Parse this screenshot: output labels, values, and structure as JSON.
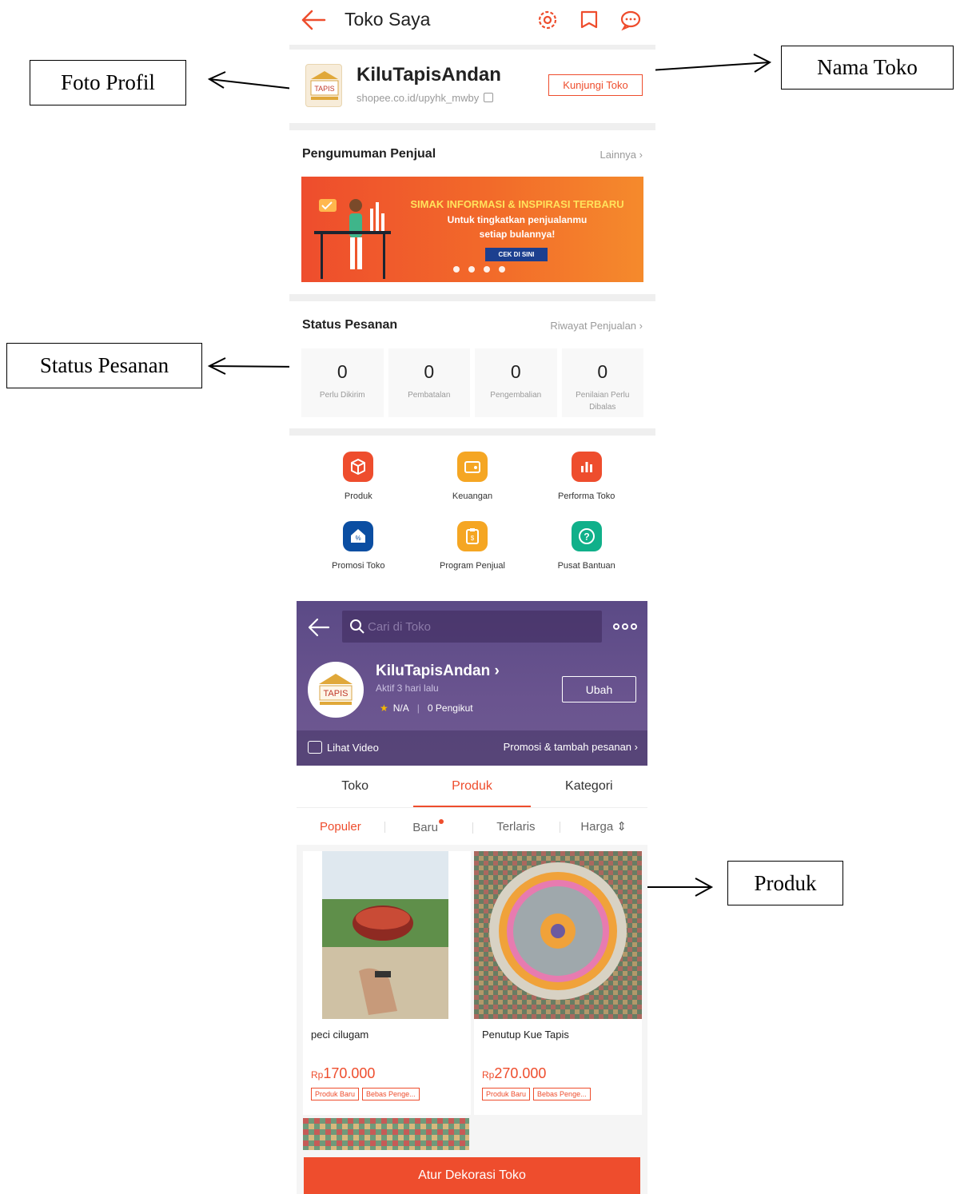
{
  "annotations": {
    "foto_profil": "Foto Profil",
    "nama_toko": "Nama Toko",
    "status_pesanan": "Status Pesanan",
    "produk": "Produk"
  },
  "screen1": {
    "title": "Toko Saya",
    "icons": [
      "settings-icon",
      "notification-icon",
      "chat-icon"
    ],
    "shop": {
      "name": "KiluTapisAndan",
      "link": "shopee.co.id/upyhk_mwby",
      "visit_button": "Kunjungi Toko",
      "avatar_text": "TAPIS"
    },
    "announcement": {
      "title": "Pengumuman Penjual",
      "more": "Lainnya",
      "banner": {
        "line1": "SIMAK INFORMASI & INSPIRASI TERBARU",
        "line2": "Untuk tingkatkan penjualanmu",
        "line3": "setiap bulannya!",
        "cta": "CEK DI SINI"
      }
    },
    "order_status": {
      "title": "Status Pesanan",
      "more": "Riwayat Penjualan",
      "items": [
        {
          "count": "0",
          "label": "Perlu Dikirim"
        },
        {
          "count": "0",
          "label": "Pembatalan"
        },
        {
          "count": "0",
          "label": "Pengembalian"
        },
        {
          "count": "0",
          "label": "Penilaian Perlu Dibalas"
        }
      ]
    },
    "menu": [
      {
        "label": "Produk",
        "color": "#ee4d2d",
        "icon": "box-icon"
      },
      {
        "label": "Keuangan",
        "color": "#f5a623",
        "icon": "wallet-icon"
      },
      {
        "label": "Performa Toko",
        "color": "#ee4d2d",
        "icon": "bar-chart-icon"
      },
      {
        "label": "Promosi Toko",
        "color": "#0b4ea2",
        "icon": "discount-icon"
      },
      {
        "label": "Program Penjual",
        "color": "#f5a623",
        "icon": "clipboard-icon"
      },
      {
        "label": "Pusat Bantuan",
        "color": "#10b08a",
        "icon": "help-icon"
      }
    ]
  },
  "screen2": {
    "search_placeholder": "Cari di Toko",
    "shop_name": "KiluTapisAndan",
    "active": "Aktif 3 hari lalu",
    "rating": "N/A",
    "followers": "0 Pengikut",
    "edit_button": "Ubah",
    "video": "Lihat Video",
    "promo": "Promosi & tambah pesanan",
    "tabs": [
      "Toko",
      "Produk",
      "Kategori"
    ],
    "sort": [
      "Populer",
      "Baru",
      "Terlaris",
      "Harga"
    ],
    "products": [
      {
        "name": "peci cilugam",
        "currency": "Rp",
        "price": "170.000",
        "tags": [
          "Produk Baru",
          "Bebas Penge..."
        ]
      },
      {
        "name": "Penutup Kue Tapis",
        "currency": "Rp",
        "price": "270.000",
        "tags": [
          "Produk Baru",
          "Bebas Penge..."
        ]
      }
    ],
    "decor_button": "Atur Dekorasi Toko"
  }
}
